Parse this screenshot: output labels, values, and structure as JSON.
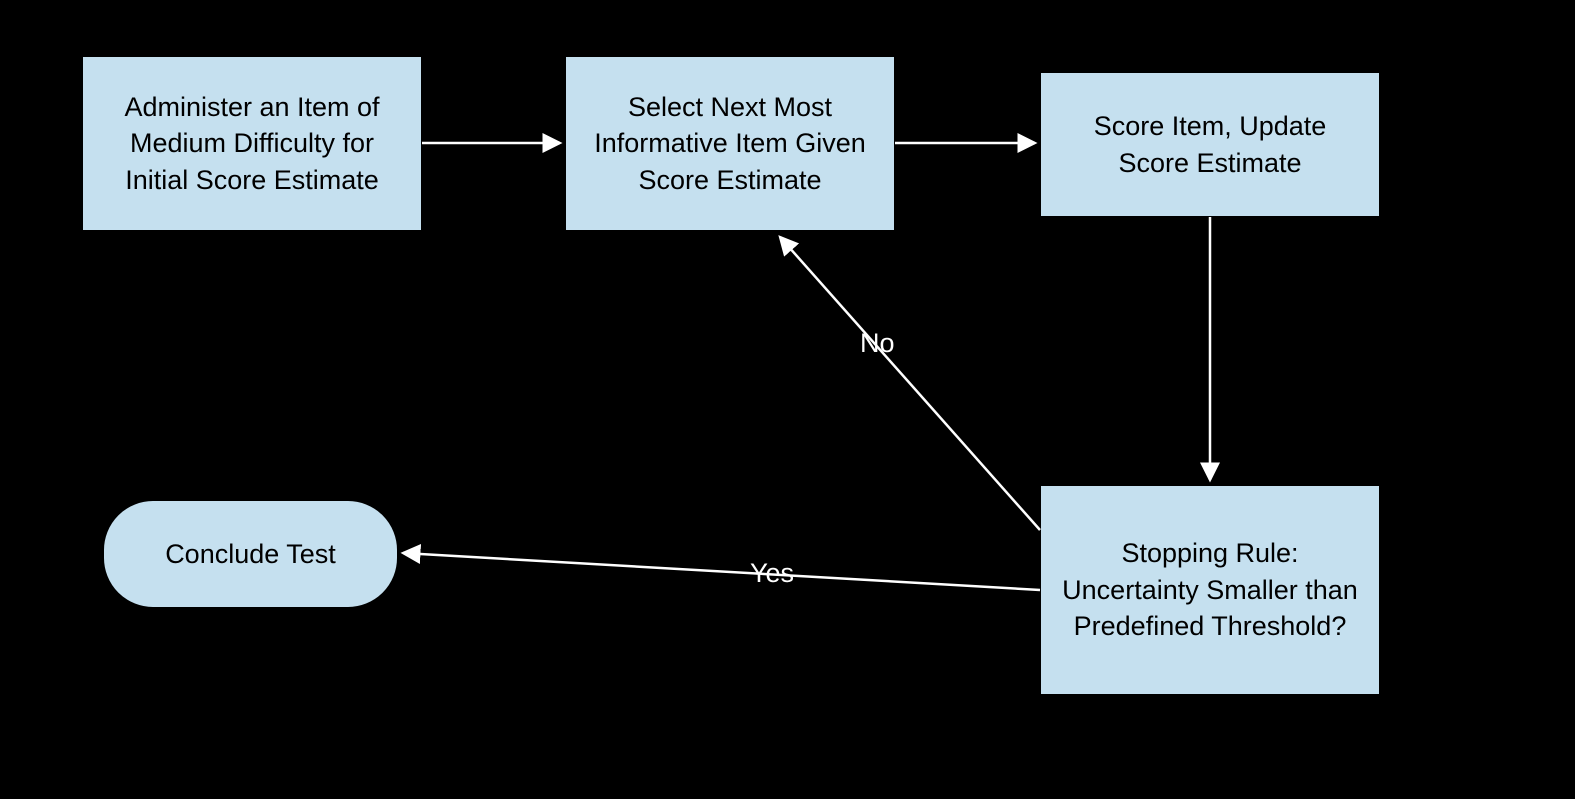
{
  "nodes": {
    "start": "Administer an Item of Medium Difficulty for Initial Score Estimate",
    "select": "Select Next Most Informative Item Given Score Estimate",
    "score": "Score Item, Update Score Estimate",
    "stop": "Stopping Rule: Uncertainty Smaller than Predefined Threshold?",
    "conclude": "Conclude Test"
  },
  "edges": {
    "yes": "Yes",
    "no": "No"
  }
}
